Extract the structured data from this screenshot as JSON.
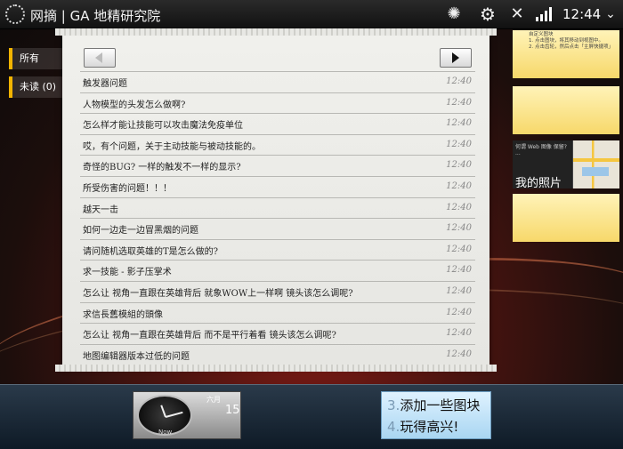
{
  "statusbar": {
    "app_title": "网摘 | GA 地精研究院",
    "time": "12:44",
    "icons": [
      "app-logo-icon",
      "sync-icon",
      "settings-gear-icon",
      "wifi-off-icon",
      "signal-icon",
      "chevron-down-icon"
    ]
  },
  "filters": [
    {
      "label": "所有"
    },
    {
      "label": "未读 (0)"
    }
  ],
  "list": {
    "items": [
      {
        "title": "触发器问题",
        "time": "12:40"
      },
      {
        "title": "人物模型的头发怎么做啊?",
        "time": "12:40"
      },
      {
        "title": "怎么样才能让技能可以攻击魔法免疫单位",
        "time": "12:40"
      },
      {
        "title": "哎，有个问题，关于主动技能与被动技能的。",
        "time": "12:40"
      },
      {
        "title": "奇怪的BUG? 一样的触发不一样的显示?",
        "time": "12:40"
      },
      {
        "title": "所受伤害的问题！！！",
        "time": "12:40"
      },
      {
        "title": "越天一击",
        "time": "12:40"
      },
      {
        "title": "如何一边走一边冒黑烟的问题",
        "time": "12:40"
      },
      {
        "title": "请问随机选取英雄的T是怎么做的?",
        "time": "12:40"
      },
      {
        "title": "求一技能 - 影子压掌术",
        "time": "12:40"
      },
      {
        "title": "怎么让 视角一直跟在英雄背后  就象WOW上一样啊  镜头该怎么调呢?",
        "time": "12:40"
      },
      {
        "title": "求信長舊模組的頭像",
        "time": "12:40"
      },
      {
        "title": "怎么让 视角一直跟在英雄背后  而不是平行着看  镜头该怎么调呢?",
        "time": "12:40"
      },
      {
        "title": "地图编辑器版本过低的问题",
        "time": "12:40"
      }
    ]
  },
  "tiles": {
    "note1_text": "自定义图块\n1. 点击图块，将其移动到视图中。\n2. 点击齿轮，然后点击「主屏快捷项」",
    "photo_small": "何谓 Web 图像 保留?\n...",
    "photo_label": "我的照片"
  },
  "dock": {
    "clock_label": "Now",
    "cal_month": "六月",
    "cal_day": "15",
    "helper_line1_num": "3.",
    "helper_line1_text": "添加一些图块",
    "helper_line2_num": "4.",
    "helper_line2_text": "玩得高兴!"
  }
}
